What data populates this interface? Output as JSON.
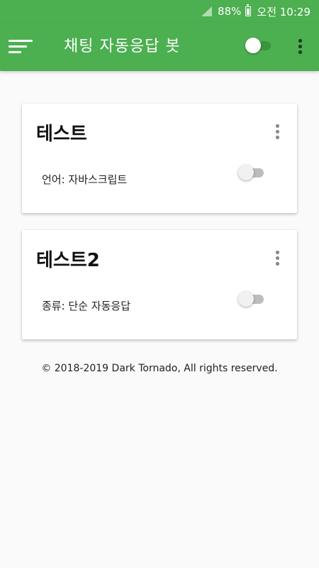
{
  "status_bar": {
    "battery": "88%",
    "time": "오전 10:29",
    "signal_icon": "signal-icon",
    "battery_icon": "battery-icon"
  },
  "app_bar": {
    "title": "채팅 자동응답 봇",
    "menu_icon": "sort-menu-icon",
    "global_toggle": false,
    "overflow_icon": "more-vertical-icon",
    "color": "#4caf50"
  },
  "bots": [
    {
      "name": "테스트",
      "detail": "언어: 자바스크립트",
      "enabled": false
    },
    {
      "name": "테스트2",
      "detail": "종류: 단순 자동응답",
      "enabled": false
    }
  ],
  "footer": "© 2018-2019 Dark Tornado, All rights reserved."
}
